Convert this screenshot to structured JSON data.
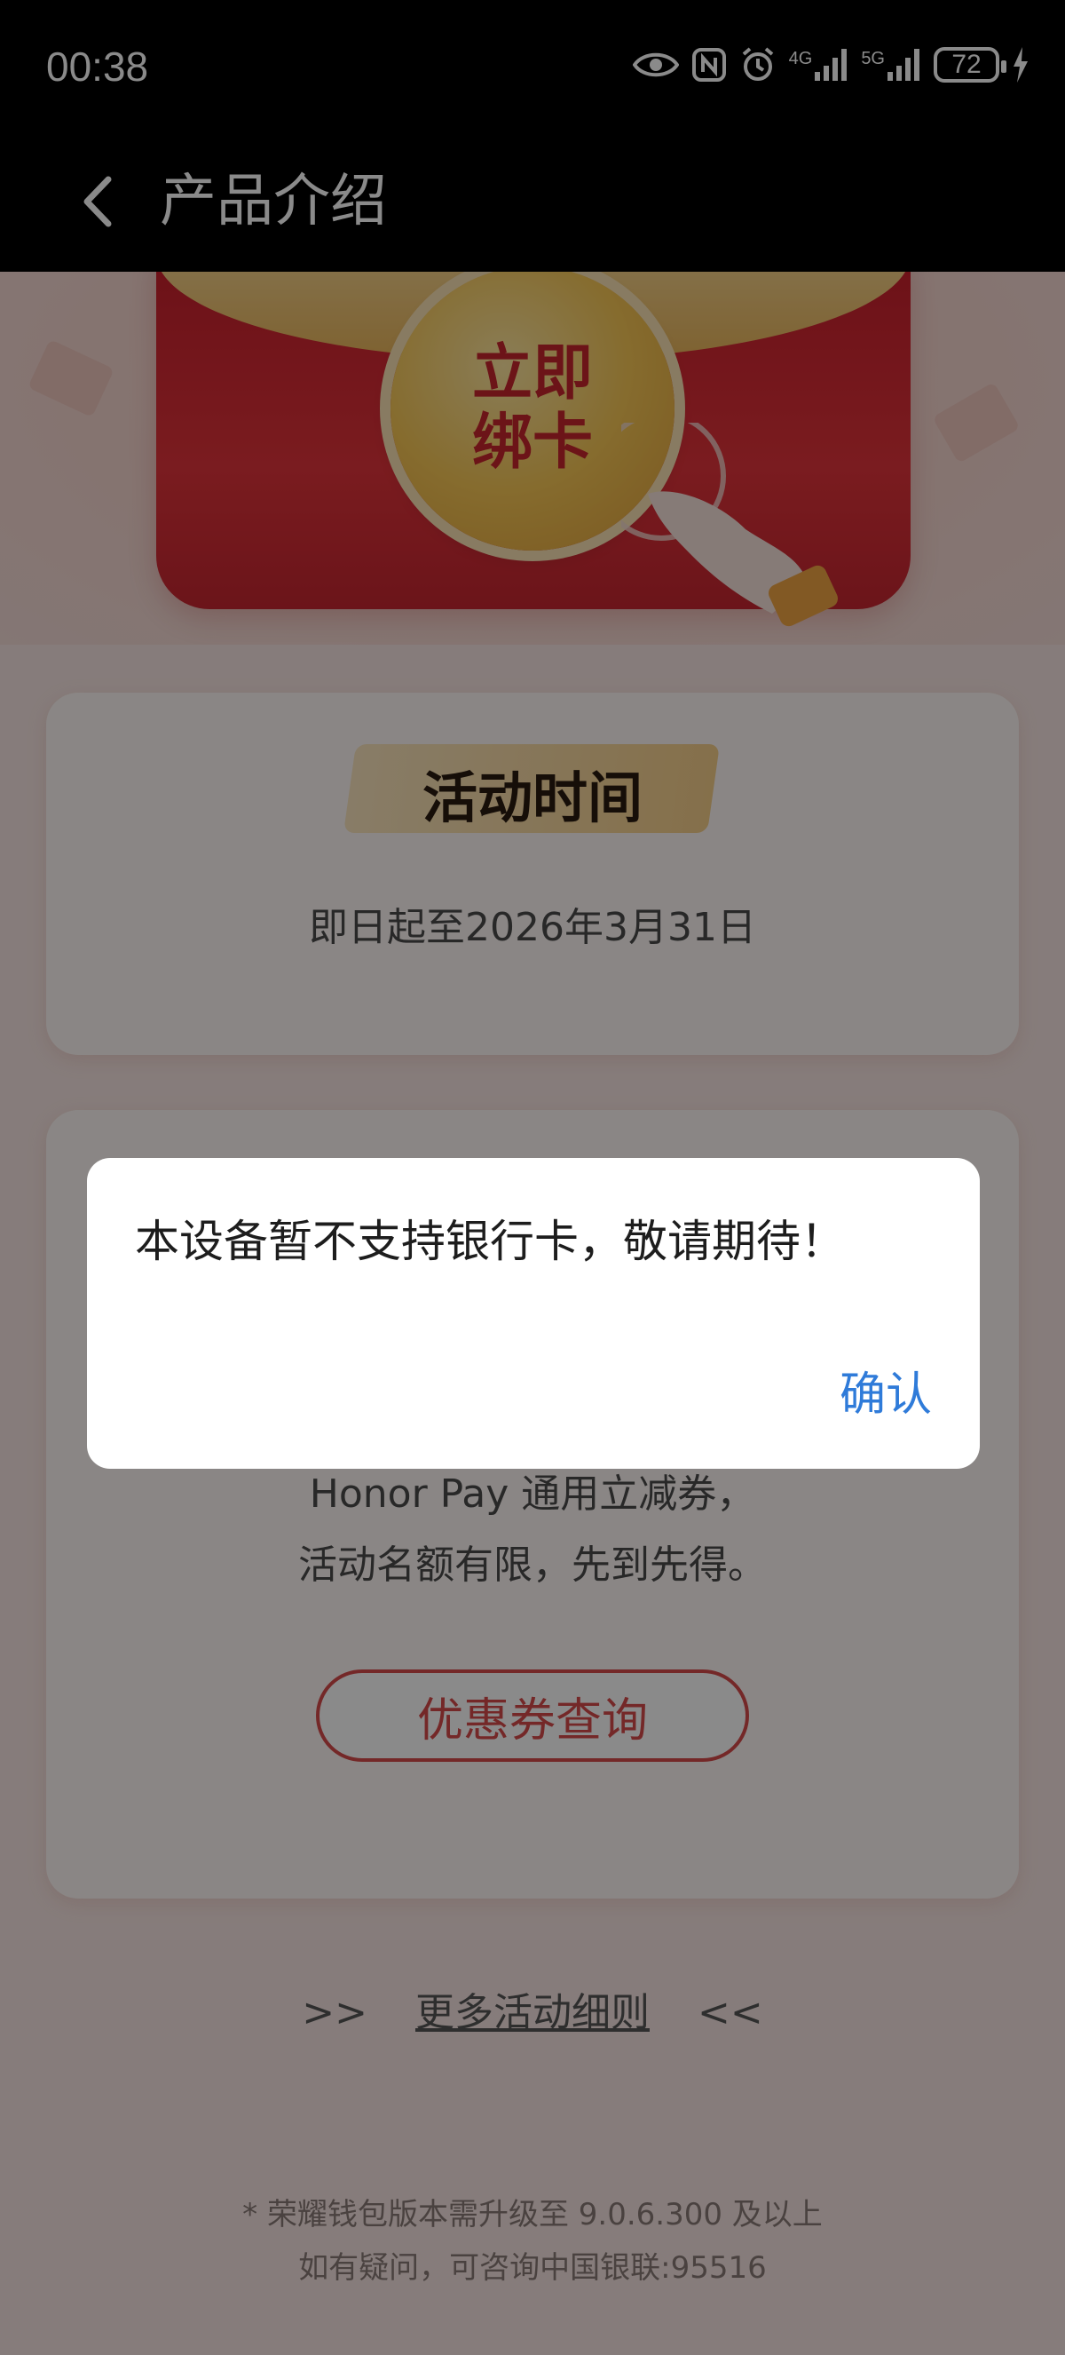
{
  "status_bar": {
    "time": "00:38",
    "network1": "4G",
    "network2": "5G",
    "battery": "72",
    "icons": [
      "eye-icon",
      "nfc-icon",
      "alarm-icon",
      "signal-4g-icon",
      "signal-5g-icon",
      "battery-icon",
      "charging-icon"
    ]
  },
  "header": {
    "title": "产品介绍",
    "back_icon": "chevron-left-icon"
  },
  "hero": {
    "coin_text_line1": "立即",
    "coin_text_line2": "绑卡"
  },
  "activity_card": {
    "tag": "活动时间",
    "period": "即日起至2026年3月31日"
  },
  "coupon_card": {
    "line1": "Honor Pay 通用立减券，",
    "line2": "活动名额有限，先到先得。",
    "button": "优惠券查询"
  },
  "more": {
    "left_arrows": ">>",
    "link": "更多活动细则",
    "right_arrows": "<<"
  },
  "footnotes": {
    "line1": "* 荣耀钱包版本需升级至 9.0.6.300 及以上",
    "line2": "如有疑问，可咨询中国银联:95516"
  },
  "dialog": {
    "message": "本设备暂不支持银行卡，敬请期待！",
    "confirm": "确认"
  },
  "colors": {
    "accent_blue": "#2f7bd9",
    "accent_red": "#d64a4a"
  }
}
